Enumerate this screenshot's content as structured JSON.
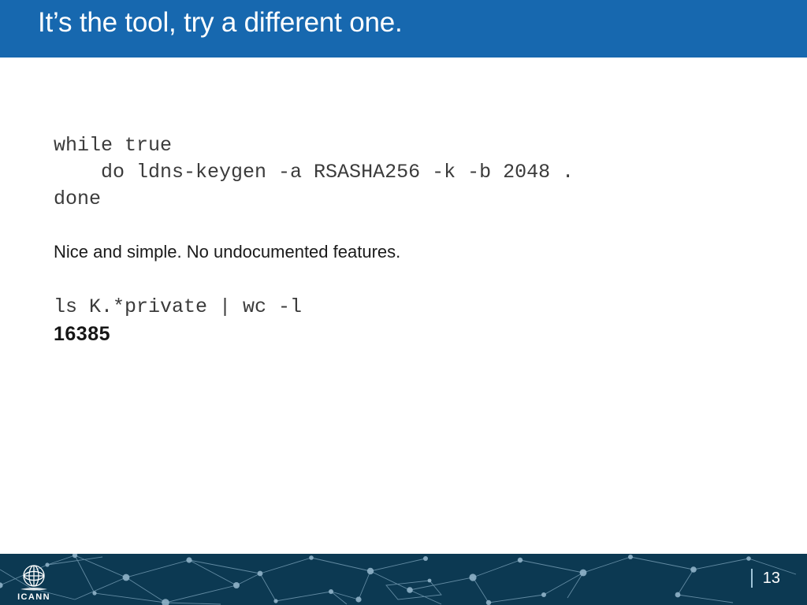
{
  "slide": {
    "title": "It’s the tool, try a different one.",
    "colors": {
      "title_bar": "#1768AF",
      "title_text": "#FFFFFF",
      "body_background": "#FFFFFF",
      "code_text": "#3B3B3B",
      "prose_text": "#1A1A1A",
      "result_text": "#161616",
      "footer_background": "#0C3952",
      "footer_network": "#7FA6BD",
      "page_number_text": "#FFFFFF"
    }
  },
  "body": {
    "code_block_1": "while true\n    do ldns-keygen -a RSASHA256 -k -b 2048 .\ndone",
    "prose": "Nice and simple. No undocumented features.",
    "code_block_2": "ls K.*private | wc -l",
    "result": "16385"
  },
  "footer": {
    "logo_name": "ICANN",
    "logo_wordmark": "ICANN",
    "separator": "|",
    "page_number": "13"
  }
}
